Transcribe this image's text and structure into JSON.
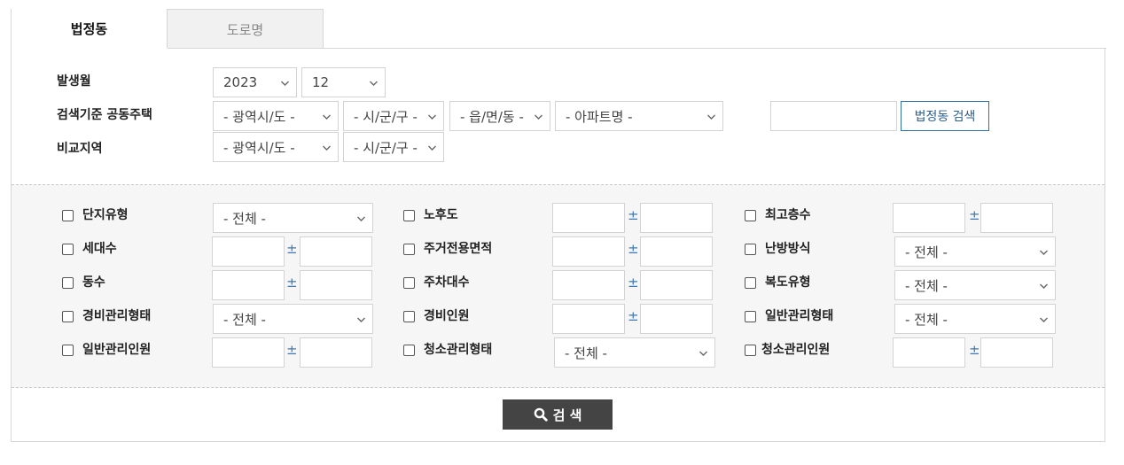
{
  "tabs": [
    {
      "label": "법정동",
      "active": true
    },
    {
      "label": "도로명",
      "active": false
    }
  ],
  "filters": {
    "occurrence_month": {
      "label": "발생월",
      "year": "2023",
      "month": "12"
    },
    "search_basis": {
      "label": "검색기준 공동주택",
      "province": "- 광역시/도 -",
      "city": "- 시/군/구 -",
      "town": "- 읍/면/동 -",
      "apartment": "- 아파트명 -",
      "button": "법정동 검색"
    },
    "compare_region": {
      "label": "비교지역",
      "province": "- 광역시/도 -",
      "city": "- 시/군/구 -"
    }
  },
  "options": {
    "plus_minus": "±",
    "all": "- 전체 -",
    "danji_type": "단지유형",
    "aging": "노후도",
    "max_floors": "최고층수",
    "households": "세대수",
    "exclusive_area": "주거전용면적",
    "heating_type": "난방방식",
    "buildings": "동수",
    "parking": "주차대수",
    "corridor_type": "복도유형",
    "security_mgmt_type": "경비관리형태",
    "security_staff": "경비인원",
    "general_mgmt_type": "일반관리형태",
    "general_mgmt_staff": "일반관리인원",
    "cleaning_mgmt_type": "청소관리형태",
    "cleaning_staff": "청소관리인원"
  },
  "search_button": "검 색",
  "colors": {
    "accent_blue": "#3f78b5",
    "button_dark": "#444444",
    "option_bg": "#f6f6f6"
  }
}
